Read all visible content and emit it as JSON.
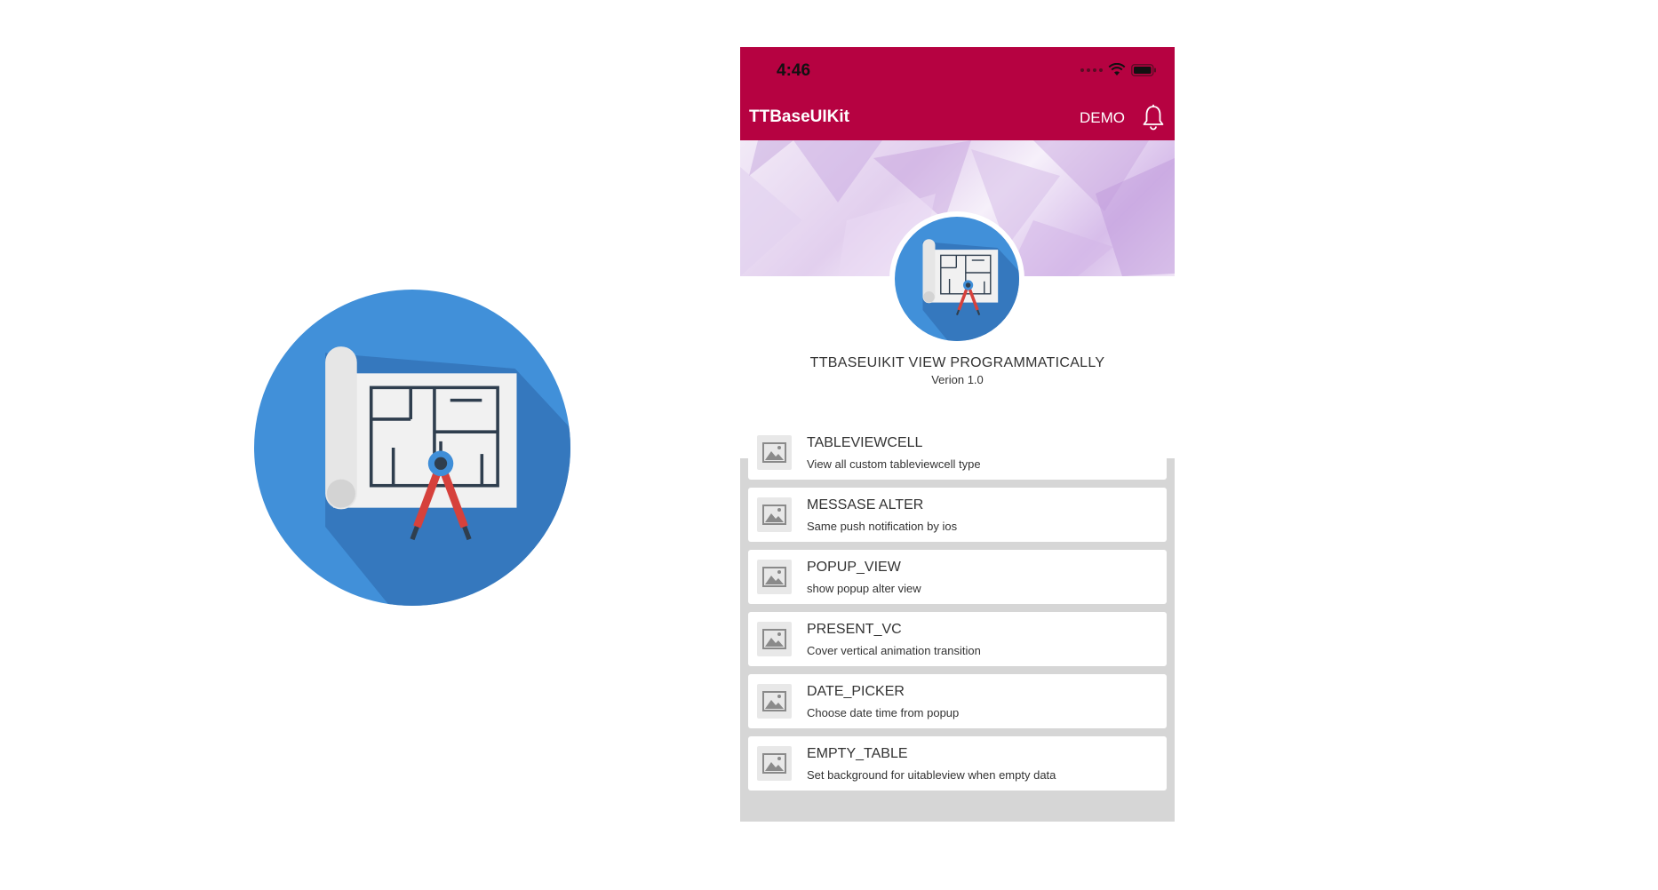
{
  "status_bar": {
    "time": "4:46"
  },
  "nav_bar": {
    "title": "TTBaseUIKit",
    "demo_label": "DEMO",
    "bell_icon": "bell-icon",
    "color": "#b60241"
  },
  "header": {
    "title": "TTBASEUIKIT VIEW PROGRAMMATICALLY",
    "version": "Verion 1.0",
    "avatar_icon": "blueprint-compass-icon"
  },
  "list": {
    "background": "#d6d6d6",
    "items": [
      {
        "title": "TABLEVIEWCELL",
        "subtitle": "View all custom tableviewcell type",
        "icon": "image-placeholder-icon"
      },
      {
        "title": "MESSASE ALTER",
        "subtitle": "Same push notification by ios",
        "icon": "image-placeholder-icon"
      },
      {
        "title": "POPUP_VIEW",
        "subtitle": "show popup alter view",
        "icon": "image-placeholder-icon"
      },
      {
        "title": "PRESENT_VC",
        "subtitle": "Cover vertical animation transition",
        "icon": "image-placeholder-icon"
      },
      {
        "title": "DATE_PICKER",
        "subtitle": "Choose date time from popup",
        "icon": "image-placeholder-icon"
      },
      {
        "title": "EMPTY_TABLE",
        "subtitle": "Set background for uitableview when empty data",
        "icon": "image-placeholder-icon"
      }
    ]
  },
  "app_logo": {
    "icon": "blueprint-compass-icon",
    "color": "#3f8ed8"
  }
}
